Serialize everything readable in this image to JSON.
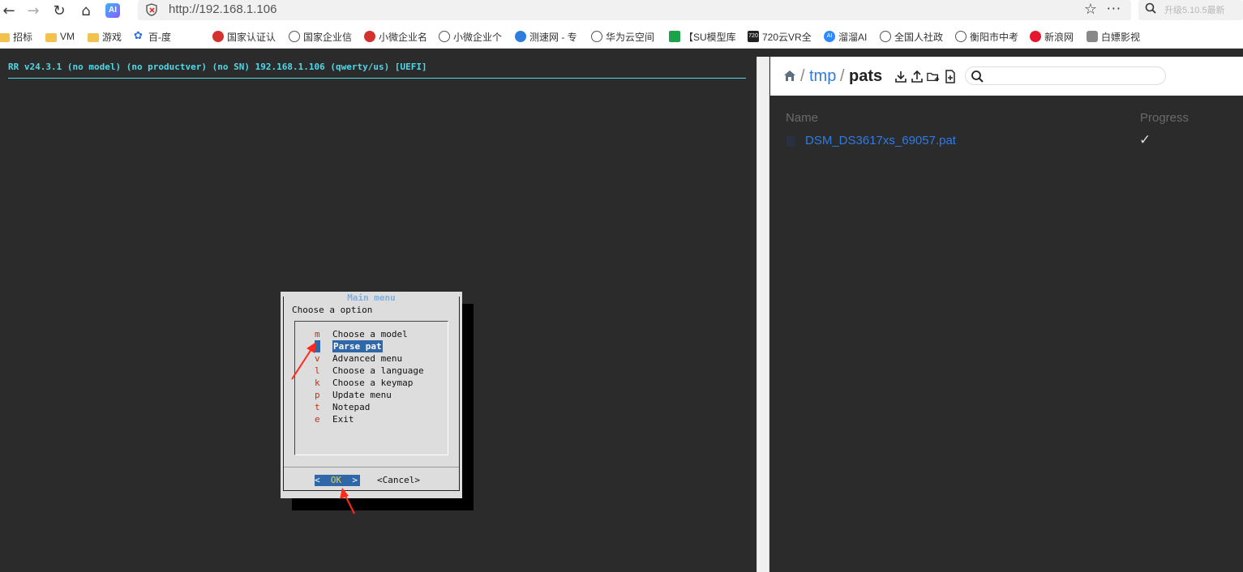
{
  "browser": {
    "url": "http://192.168.1.106",
    "search_hint": "升级5.10.5最新",
    "ai_badge": "AI",
    "bookmarks": [
      {
        "label": "招标",
        "icon": "folder-icon"
      },
      {
        "label": "VM",
        "icon": "folder-icon"
      },
      {
        "label": "游戏",
        "icon": "folder-icon"
      },
      {
        "label": "百-度",
        "icon": "paw-icon"
      },
      {
        "label": "国家认证认",
        "icon": "emblem-icon"
      },
      {
        "label": "国家企业信",
        "icon": "globe-icon"
      },
      {
        "label": "小微企业名",
        "icon": "emblem-icon"
      },
      {
        "label": "小微企业个",
        "icon": "globe-icon"
      },
      {
        "label": "测速网 - 专",
        "icon": "speed-icon"
      },
      {
        "label": "华为云空间",
        "icon": "globe-icon"
      },
      {
        "label": "【SU模型库",
        "icon": "green-icon"
      },
      {
        "label": "720云VR全",
        "icon": "720-icon"
      },
      {
        "label": "溜溜AI",
        "icon": "ai-icon"
      },
      {
        "label": "全国人社政",
        "icon": "globe-icon"
      },
      {
        "label": "衡阳市中考",
        "icon": "globe-icon"
      },
      {
        "label": "新浪网",
        "icon": "weibo-icon"
      },
      {
        "label": "白嫖影视",
        "icon": "film-icon"
      }
    ]
  },
  "terminal": {
    "header": "RR v24.3.1 (no model) (no productver) (no SN) 192.168.1.106 (qwerty/us) [UEFI]",
    "dialog": {
      "title": "Main menu",
      "prompt": "Choose a option",
      "items": [
        {
          "key": "m",
          "label": "Choose a model",
          "selected": false
        },
        {
          "key": "s",
          "label": "Parse pat",
          "selected": true
        },
        {
          "key": "v",
          "label": "Advanced menu",
          "selected": false
        },
        {
          "key": "l",
          "label": "Choose a language",
          "selected": false
        },
        {
          "key": "k",
          "label": "Choose a keymap",
          "selected": false
        },
        {
          "key": "p",
          "label": "Update menu",
          "selected": false
        },
        {
          "key": "t",
          "label": "Notepad",
          "selected": false
        },
        {
          "key": "e",
          "label": "Exit",
          "selected": false
        }
      ],
      "ok_label": "OK",
      "cancel_label": "<Cancel>"
    }
  },
  "file_browser": {
    "breadcrumb": [
      {
        "label": "tmp",
        "sep": "/"
      },
      {
        "label": "pats",
        "sep": "/"
      }
    ],
    "columns": {
      "name": "Name",
      "progress": "Progress"
    },
    "files": [
      {
        "name": "DSM_DS3617xs_69057.pat",
        "progress": "✓"
      }
    ]
  },
  "colors": {
    "terminal_accent": "#4fd8e8",
    "selected_bg": "#2f67a8",
    "hotkey": "#c1320f",
    "link": "#2f7ae5",
    "annotation_arrow": "#ff2a1a"
  }
}
